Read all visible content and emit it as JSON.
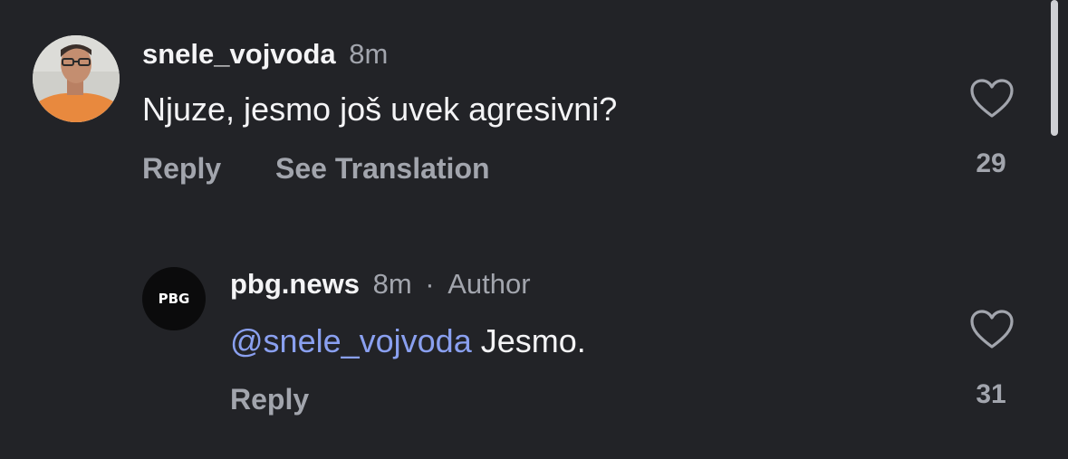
{
  "comments": [
    {
      "username": "snele_vojvoda",
      "time": "8m",
      "text": "Njuze, jesmo još uvek agresivni?",
      "reply_label": "Reply",
      "translate_label": "See Translation",
      "likes": "29"
    }
  ],
  "reply": {
    "username": "pbg.news",
    "time": "8m",
    "separator": "·",
    "badge": "Author",
    "avatar_text": "PBG",
    "mention": "@snele_vojvoda",
    "text": " Jesmo.",
    "reply_label": "Reply",
    "likes": "31"
  },
  "icons": {
    "like": "heart-icon"
  },
  "colors": {
    "background": "#222327",
    "mention": "#8aa0f0",
    "muted": "#a2a5ad"
  }
}
